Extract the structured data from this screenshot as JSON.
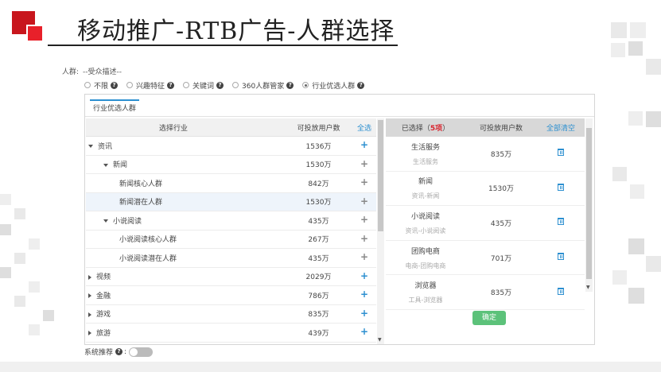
{
  "slide": {
    "title": "移动推广-RTB广告-人群选择"
  },
  "crowd": {
    "label": "人群:",
    "value": "--受众描述--"
  },
  "radios": [
    {
      "label": "不限",
      "selected": false
    },
    {
      "label": "兴趣特征",
      "selected": false
    },
    {
      "label": "关键词",
      "selected": false
    },
    {
      "label": "360人群管家",
      "selected": false
    },
    {
      "label": "行业优选人群",
      "selected": true
    }
  ],
  "help_glyph": "?",
  "tab": {
    "label": "行业优选人群"
  },
  "left_table": {
    "headers": {
      "industry": "选择行业",
      "users": "可投放用户数",
      "select_all": "全选"
    },
    "rows": [
      {
        "name": "资讯",
        "count": "1536万",
        "level": 0,
        "expand": "down",
        "add": "blue"
      },
      {
        "name": "新闻",
        "count": "1530万",
        "level": 1,
        "expand": "down",
        "add": "gray"
      },
      {
        "name": "新闻核心人群",
        "count": "842万",
        "level": 2,
        "expand": "none",
        "add": "gray"
      },
      {
        "name": "新闻潜在人群",
        "count": "1530万",
        "level": 2,
        "expand": "none",
        "add": "gray",
        "highlight": true
      },
      {
        "name": "小说阅读",
        "count": "435万",
        "level": 1,
        "expand": "down",
        "add": "gray"
      },
      {
        "name": "小说阅读核心人群",
        "count": "267万",
        "level": 2,
        "expand": "none",
        "add": "gray"
      },
      {
        "name": "小说阅读潜在人群",
        "count": "435万",
        "level": 2,
        "expand": "none",
        "add": "gray"
      },
      {
        "name": "视频",
        "count": "2029万",
        "level": 0,
        "expand": "right",
        "add": "blue"
      },
      {
        "name": "金融",
        "count": "786万",
        "level": 0,
        "expand": "right",
        "add": "blue"
      },
      {
        "name": "游戏",
        "count": "835万",
        "level": 0,
        "expand": "right",
        "add": "blue"
      },
      {
        "name": "旅游",
        "count": "439万",
        "level": 0,
        "expand": "right",
        "add": "blue"
      }
    ]
  },
  "right_table": {
    "headers": {
      "selected_prefix": "已选择（",
      "selected_count": "5项",
      "selected_suffix": "）",
      "users": "可投放用户数",
      "clear_all": "全部清空"
    },
    "rows": [
      {
        "name": "生活服务",
        "path": "生活服务",
        "count": "835万"
      },
      {
        "name": "新闻",
        "path": "资讯-新闻",
        "count": "1530万"
      },
      {
        "name": "小说阅读",
        "path": "资讯-小说阅读",
        "count": "435万"
      },
      {
        "name": "团购电商",
        "path": "电商-团购电商",
        "count": "701万"
      },
      {
        "name": "浏览器",
        "path": "工具-浏览器",
        "count": "835万"
      }
    ]
  },
  "confirm_label": "确定",
  "system_recommend": {
    "label": "系统推荐",
    "colon": ":",
    "enabled": false
  },
  "colors": {
    "accent": "#2c8fd0",
    "confirm": "#5cc27a",
    "logo": "#c8161d",
    "count_highlight": "#d9232d"
  }
}
